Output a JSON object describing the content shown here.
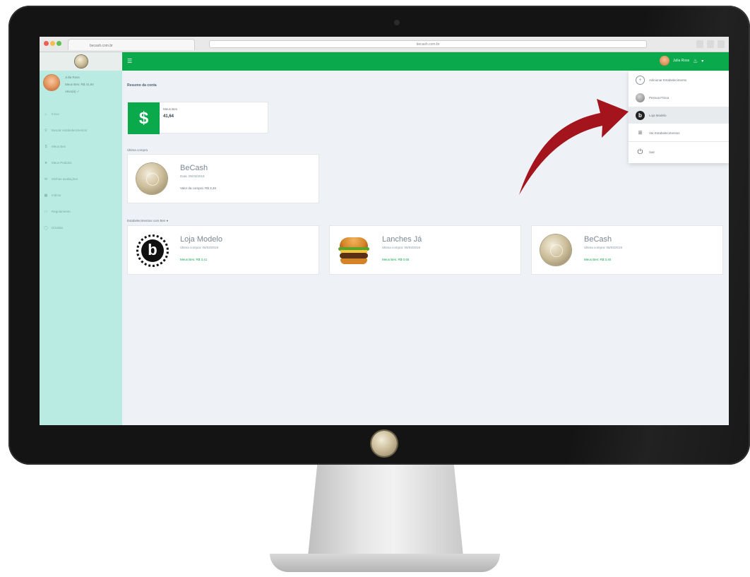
{
  "browser": {
    "tab_title": "becash.com.br",
    "url": "becash.com.br"
  },
  "topbar": {
    "menu_icon": "menu-icon",
    "user_name": "Julia Ross",
    "notification_icon": "bell-icon"
  },
  "sidebar": {
    "profile": {
      "name": "Julia Ross",
      "balance": "Meus Bes: R$ 41,64",
      "status": "Ativo(a) ✓"
    },
    "items": [
      {
        "icon": "home-icon",
        "label": "Início"
      },
      {
        "icon": "search-icon",
        "label": "Buscar estabelecimentos"
      },
      {
        "icon": "dollar-icon",
        "label": "Meus Bes"
      },
      {
        "icon": "star-icon",
        "label": "Meus Pedidos"
      },
      {
        "icon": "chat-icon",
        "label": "Minhas avaliações"
      },
      {
        "icon": "grid-icon",
        "label": "Indicar"
      },
      {
        "icon": "doc-icon",
        "label": "Regulamento"
      },
      {
        "icon": "help-icon",
        "label": "Dúvidas"
      }
    ]
  },
  "main": {
    "title": "Resumo da conta",
    "saldo": {
      "label": "Meus Bes",
      "value": "41,64"
    },
    "recent_label": "Última compra",
    "recent_card": {
      "title": "BeCash",
      "sub": "Data: 05/03/2019",
      "extra": "Valor da compra: R$ 3,45"
    },
    "stores_label": "Estabelecimentos com Bes ●",
    "stores": [
      {
        "title": "Loja Modelo",
        "sub": "Última compra: 05/03/2019",
        "link": "Meus Bes: R$ 3,41"
      },
      {
        "title": "Lanches Já",
        "sub": "Última compra: 05/03/2019",
        "link": "Meus Bes: R$ 0,55"
      },
      {
        "title": "BeCash",
        "sub": "Última compra: 05/03/2019",
        "link": "Meus Bes: R$ 3,40"
      }
    ]
  },
  "dropdown": {
    "items": [
      {
        "label": "Adicionar Estabelecimento",
        "icon": "plus-circle-icon"
      },
      {
        "label": "Pessoa Física",
        "icon": "coin-icon"
      },
      {
        "label": "Loja Modelo",
        "icon": "store-b-icon"
      },
      {
        "label": "Ver Estabelecimentos",
        "icon": "list-icon"
      },
      {
        "label": "Sair",
        "icon": "power-icon"
      }
    ]
  },
  "colors": {
    "brand_green": "#0aa94c",
    "sidebar_teal": "#b9ebe3",
    "arrow_red": "#a3141c"
  }
}
